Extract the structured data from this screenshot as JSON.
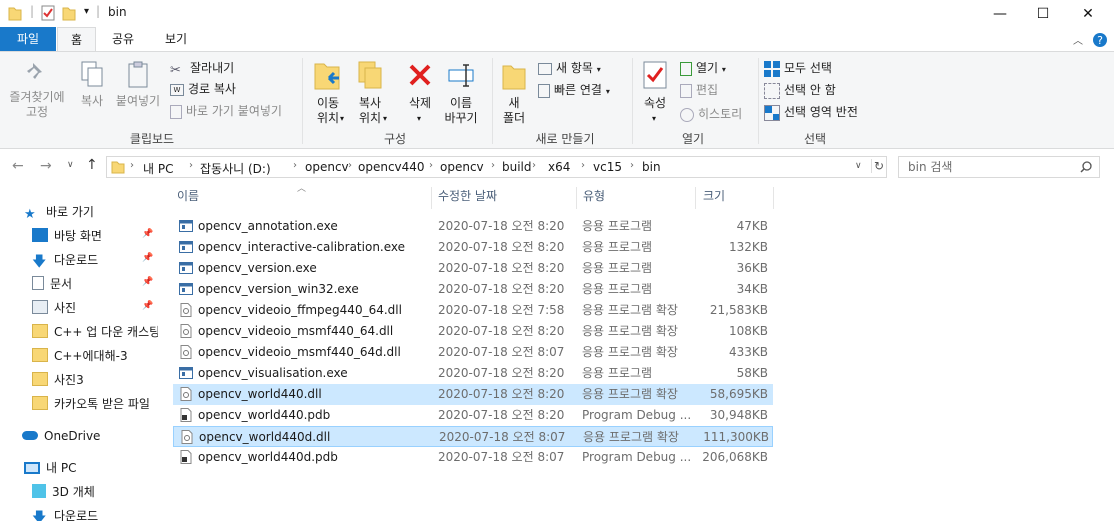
{
  "window": {
    "title": "bin",
    "minimize": "—",
    "maximize": "☐",
    "close": "✕"
  },
  "tabs": [
    "파일",
    "홈",
    "공유",
    "보기"
  ],
  "ribbon": {
    "clipboard": {
      "pin_label_1": "즐겨찾기에",
      "pin_label_2": "고정",
      "copy": "복사",
      "paste": "붙여넣기",
      "cut": "잘라내기",
      "copy_path": "경로 복사",
      "paste_shortcut": "바로 가기 붙여넣기",
      "group": "클립보드"
    },
    "organize": {
      "move_1": "이동",
      "move_2": "위치",
      "copyto_1": "복사",
      "copyto_2": "위치",
      "delete": "삭제",
      "rename_1": "이름",
      "rename_2": "바꾸기",
      "group": "구성"
    },
    "new": {
      "folder_1": "새",
      "folder_2": "폴더",
      "new_item": "새 항목",
      "easy_access": "빠른 연결",
      "group": "새로 만들기"
    },
    "open": {
      "properties": "속성",
      "open": "열기",
      "edit": "편집",
      "history": "히스토리",
      "group": "열기"
    },
    "select": {
      "select_all": "모두 선택",
      "select_none": "선택 안 함",
      "invert": "선택 영역 반전",
      "group": "선택"
    }
  },
  "address": {
    "crumbs": [
      "내 PC",
      "잡동사니 (D:)",
      "opencv",
      "opencv440",
      "opencv",
      "build",
      "x64",
      "vc15",
      "bin"
    ],
    "search_placeholder": "bin 검색"
  },
  "nav": {
    "quick_access": "바로 가기",
    "items": [
      {
        "label": "바탕 화면",
        "icon": "desktop-icon",
        "pinned": true
      },
      {
        "label": "다운로드",
        "icon": "download-icon",
        "pinned": true
      },
      {
        "label": "문서",
        "icon": "document-icon",
        "pinned": true
      },
      {
        "label": "사진",
        "icon": "pictures-icon",
        "pinned": true
      },
      {
        "label": "C++ 업 다운 캐스팅",
        "icon": "folder-icon",
        "pinned": false
      },
      {
        "label": "C++에대해-3",
        "icon": "folder-icon",
        "pinned": false
      },
      {
        "label": "사진3",
        "icon": "folder-icon",
        "pinned": false
      },
      {
        "label": "카카오톡 받은 파일",
        "icon": "folder-icon",
        "pinned": false
      }
    ],
    "onedrive": "OneDrive",
    "this_pc": "내 PC",
    "objects_3d": "3D 개체",
    "downloads": "다운로드"
  },
  "columns": {
    "name": "이름",
    "date": "수정한 날짜",
    "type": "유형",
    "size": "크기"
  },
  "files": [
    {
      "name": "opencv_annotation.exe",
      "date": "2020-07-18 오전 8:20",
      "type": "응용 프로그램",
      "size": "47KB",
      "kind": "exe"
    },
    {
      "name": "opencv_interactive-calibration.exe",
      "date": "2020-07-18 오전 8:20",
      "type": "응용 프로그램",
      "size": "132KB",
      "kind": "exe"
    },
    {
      "name": "opencv_version.exe",
      "date": "2020-07-18 오전 8:20",
      "type": "응용 프로그램",
      "size": "36KB",
      "kind": "exe"
    },
    {
      "name": "opencv_version_win32.exe",
      "date": "2020-07-18 오전 8:20",
      "type": "응용 프로그램",
      "size": "34KB",
      "kind": "exe"
    },
    {
      "name": "opencv_videoio_ffmpeg440_64.dll",
      "date": "2020-07-18 오전 7:58",
      "type": "응용 프로그램 확장",
      "size": "21,583KB",
      "kind": "dll"
    },
    {
      "name": "opencv_videoio_msmf440_64.dll",
      "date": "2020-07-18 오전 8:20",
      "type": "응용 프로그램 확장",
      "size": "108KB",
      "kind": "dll"
    },
    {
      "name": "opencv_videoio_msmf440_64d.dll",
      "date": "2020-07-18 오전 8:07",
      "type": "응용 프로그램 확장",
      "size": "433KB",
      "kind": "dll"
    },
    {
      "name": "opencv_visualisation.exe",
      "date": "2020-07-18 오전 8:20",
      "type": "응용 프로그램",
      "size": "58KB",
      "kind": "exe"
    },
    {
      "name": "opencv_world440.dll",
      "date": "2020-07-18 오전 8:20",
      "type": "응용 프로그램 확장",
      "size": "58,695KB",
      "kind": "dll"
    },
    {
      "name": "opencv_world440.pdb",
      "date": "2020-07-18 오전 8:20",
      "type": "Program Debug ...",
      "size": "30,948KB",
      "kind": "pdb"
    },
    {
      "name": "opencv_world440d.dll",
      "date": "2020-07-18 오전 8:07",
      "type": "응용 프로그램 확장",
      "size": "111,300KB",
      "kind": "dll"
    },
    {
      "name": "opencv_world440d.pdb",
      "date": "2020-07-18 오전 8:07",
      "type": "Program Debug ...",
      "size": "206,068KB",
      "kind": "pdb"
    }
  ]
}
